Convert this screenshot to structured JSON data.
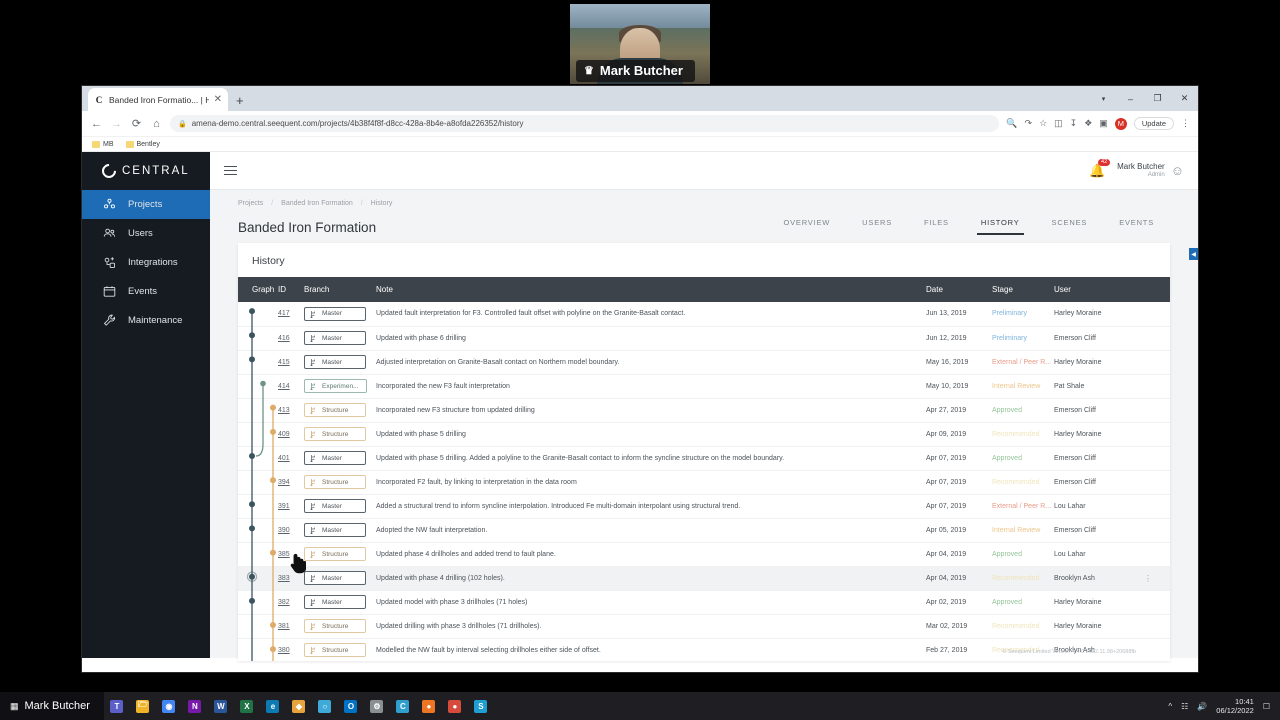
{
  "video": {
    "participant_name": "Mark Butcher",
    "crown_icon": "crown-icon"
  },
  "browser": {
    "tab_title": "Banded Iron Formatio... | History",
    "tab_favicon_letter": "C",
    "new_tab_label": "+",
    "close_tab_label": "✕",
    "window_minimize": "–",
    "window_maximize": "❐",
    "window_close": "✕",
    "back": "←",
    "forward": "→",
    "reload": "⟳",
    "home": "⌂",
    "lock_icon": "🔒",
    "url": "amena-demo.central.seequent.com/projects/4b38f4f8f-d8cc-428a-8b4e-a8ofda226352/history",
    "update_label": "Update",
    "profile_initial": "M",
    "menu_dots": "⋮",
    "toolbar_icons": [
      "zoom-icon",
      "share-icon",
      "star-icon",
      "cast-icon",
      "extension-puzzle-icon",
      "sidepanel-icon"
    ],
    "bookmarks": [
      {
        "label": "MB"
      },
      {
        "label": "Bentley"
      }
    ]
  },
  "app": {
    "brand": "CENTRAL",
    "sidebar": {
      "items": [
        {
          "label": "Projects",
          "icon": "projects-icon",
          "active": true
        },
        {
          "label": "Users",
          "icon": "users-icon",
          "active": false
        },
        {
          "label": "Integrations",
          "icon": "integrations-icon",
          "active": false
        },
        {
          "label": "Events",
          "icon": "events-calendar-icon",
          "active": false
        },
        {
          "label": "Maintenance",
          "icon": "maintenance-wrench-icon",
          "active": false
        }
      ]
    },
    "header": {
      "hamburger_icon": "hamburger-menu-icon",
      "bell_icon": "notification-bell-icon",
      "bell_badge": "42",
      "user_name": "Mark Butcher",
      "user_role": "Admin",
      "user_avatar_icon": "user-avatar-icon"
    },
    "breadcrumb": [
      "Projects",
      "Banded Iron Formation",
      "History"
    ],
    "page_title": "Banded Iron Formation",
    "tabs": [
      {
        "label": "OVERVIEW",
        "active": false
      },
      {
        "label": "USERS",
        "active": false
      },
      {
        "label": "FILES",
        "active": false
      },
      {
        "label": "HISTORY",
        "active": true
      },
      {
        "label": "SCENES",
        "active": false
      },
      {
        "label": "EVENTS",
        "active": false
      }
    ],
    "card_title": "History",
    "table": {
      "columns": [
        "Graph",
        "ID",
        "Branch",
        "Note",
        "Date",
        "Stage",
        "User"
      ],
      "rows": [
        {
          "id": "417",
          "branch": "Master",
          "branch_type": "master",
          "note": "Updated fault interpretation for F3. Controlled fault offset with polyline on the Granite-Basalt contact.",
          "date": "Jun 13, 2019",
          "stage": "Preliminary",
          "stage_class": "preliminary",
          "user": "Harley Moraine"
        },
        {
          "id": "416",
          "branch": "Master",
          "branch_type": "master",
          "note": "Updated with phase 6 drilling",
          "date": "Jun 12, 2019",
          "stage": "Preliminary",
          "stage_class": "preliminary",
          "user": "Emerson Cliff"
        },
        {
          "id": "415",
          "branch": "Master",
          "branch_type": "master",
          "note": "Adjusted interpretation on Granite-Basalt contact on Northern model boundary.",
          "date": "May 16, 2019",
          "stage": "External / Peer R...",
          "stage_class": "external",
          "user": "Harley Moraine"
        },
        {
          "id": "414",
          "branch": "Experimen...",
          "branch_type": "experimental",
          "note": "Incorporated the new F3 fault interpretation",
          "date": "May 10, 2019",
          "stage": "Internal Review",
          "stage_class": "internal",
          "user": "Pat Shale"
        },
        {
          "id": "413",
          "branch": "Structure",
          "branch_type": "structure",
          "note": "Incorporated new F3 structure from updated drilling",
          "date": "Apr 27, 2019",
          "stage": "Approved",
          "stage_class": "approved",
          "user": "Emerson Cliff"
        },
        {
          "id": "409",
          "branch": "Structure",
          "branch_type": "structure",
          "note": "Updated with phase 5 drilling",
          "date": "Apr 09, 2019",
          "stage": "Recommended",
          "stage_class": "recommended",
          "user": "Harley Moraine"
        },
        {
          "id": "401",
          "branch": "Master",
          "branch_type": "master",
          "note": "Updated with phase 5 drilling. Added a polyline to the Granite-Basalt contact to inform the syncline structure on the model boundary.",
          "date": "Apr 07, 2019",
          "stage": "Approved",
          "stage_class": "approved",
          "user": "Emerson Cliff"
        },
        {
          "id": "394",
          "branch": "Structure",
          "branch_type": "structure",
          "note": "Incorporated F2 fault, by linking to interpretation in the data room",
          "date": "Apr 07, 2019",
          "stage": "Recommended",
          "stage_class": "recommended",
          "user": "Emerson Cliff"
        },
        {
          "id": "391",
          "branch": "Master",
          "branch_type": "master",
          "note": "Added a structural trend to inform syncline interpolation. Introduced Fe multi-domain interpolant using structural trend.",
          "date": "Apr 07, 2019",
          "stage": "External / Peer R...",
          "stage_class": "external",
          "user": "Lou Lahar"
        },
        {
          "id": "390",
          "branch": "Master",
          "branch_type": "master",
          "note": "Adopted the NW fault interpretation.",
          "date": "Apr 05, 2019",
          "stage": "Internal Review",
          "stage_class": "internal",
          "user": "Emerson Cliff"
        },
        {
          "id": "385",
          "branch": "Structure",
          "branch_type": "structure",
          "note": "Updated phase 4 drillholes and added trend to fault plane.",
          "date": "Apr 04, 2019",
          "stage": "Approved",
          "stage_class": "approved",
          "user": "Lou Lahar"
        },
        {
          "id": "383",
          "branch": "Master",
          "branch_type": "master",
          "note": "Updated with phase 4 drilling (102 holes).",
          "date": "Apr 04, 2019",
          "stage": "Recommended",
          "stage_class": "recommended",
          "user": "Brooklyn Ash",
          "highlight": true,
          "menu": "⋮"
        },
        {
          "id": "382",
          "branch": "Master",
          "branch_type": "master",
          "note": "Updated model with phase 3 drillholes (71 holes)",
          "date": "Apr 02, 2019",
          "stage": "Approved",
          "stage_class": "approved",
          "user": "Harley Moraine"
        },
        {
          "id": "381",
          "branch": "Structure",
          "branch_type": "structure",
          "note": "Updated drilling with phase 3 drillholes (71 drillholes).",
          "date": "Mar 02, 2019",
          "stage": "Recommended",
          "stage_class": "recommended",
          "user": "Harley Moraine"
        },
        {
          "id": "380",
          "branch": "Structure",
          "branch_type": "structure",
          "note": "Modelled the NW fault by interval selecting drillholes either side of offset.",
          "date": "Feb 27, 2019",
          "stage": "Recommended",
          "stage_class": "recommended",
          "user": "Brooklyn Ash"
        }
      ]
    },
    "footnote": "© Seequent Limited    Version 4.4.0 2022.11.98+20688fb",
    "collapse_icon": "chevron-left-icon"
  },
  "taskbar": {
    "start_label": "Mark Butcher",
    "start_icon": "windows-start-icon",
    "apps": [
      {
        "name": "teams-icon",
        "glyph": "T",
        "color": "#5b5fc7"
      },
      {
        "name": "file-explorer-icon",
        "glyph": "🗁",
        "color": "#f0b429"
      },
      {
        "name": "chrome-icon",
        "glyph": "◉",
        "color": "#4285f4"
      },
      {
        "name": "onenote-icon",
        "glyph": "N",
        "color": "#7719aa"
      },
      {
        "name": "word-icon",
        "glyph": "W",
        "color": "#2b579a"
      },
      {
        "name": "excel-icon",
        "glyph": "X",
        "color": "#217346"
      },
      {
        "name": "edge-icon",
        "glyph": "e",
        "color": "#0e7ab4"
      },
      {
        "name": "leapfrog-icon",
        "glyph": "◆",
        "color": "#e8a33d"
      },
      {
        "name": "search-icon",
        "glyph": "○",
        "color": "#3fa9d8"
      },
      {
        "name": "outlook-icon",
        "glyph": "O",
        "color": "#0072c6"
      },
      {
        "name": "settings-icon",
        "glyph": "⚙",
        "color": "#8a8f94"
      },
      {
        "name": "central-icon",
        "glyph": "C",
        "color": "#2f9fd0"
      },
      {
        "name": "orange-app-icon",
        "glyph": "●",
        "color": "#ee7623"
      },
      {
        "name": "red-app-icon",
        "glyph": "●",
        "color": "#d64b3b"
      },
      {
        "name": "seequent-icon",
        "glyph": "S",
        "color": "#1f9ed4"
      }
    ],
    "time": "10:41",
    "date": "06/12/2022"
  }
}
